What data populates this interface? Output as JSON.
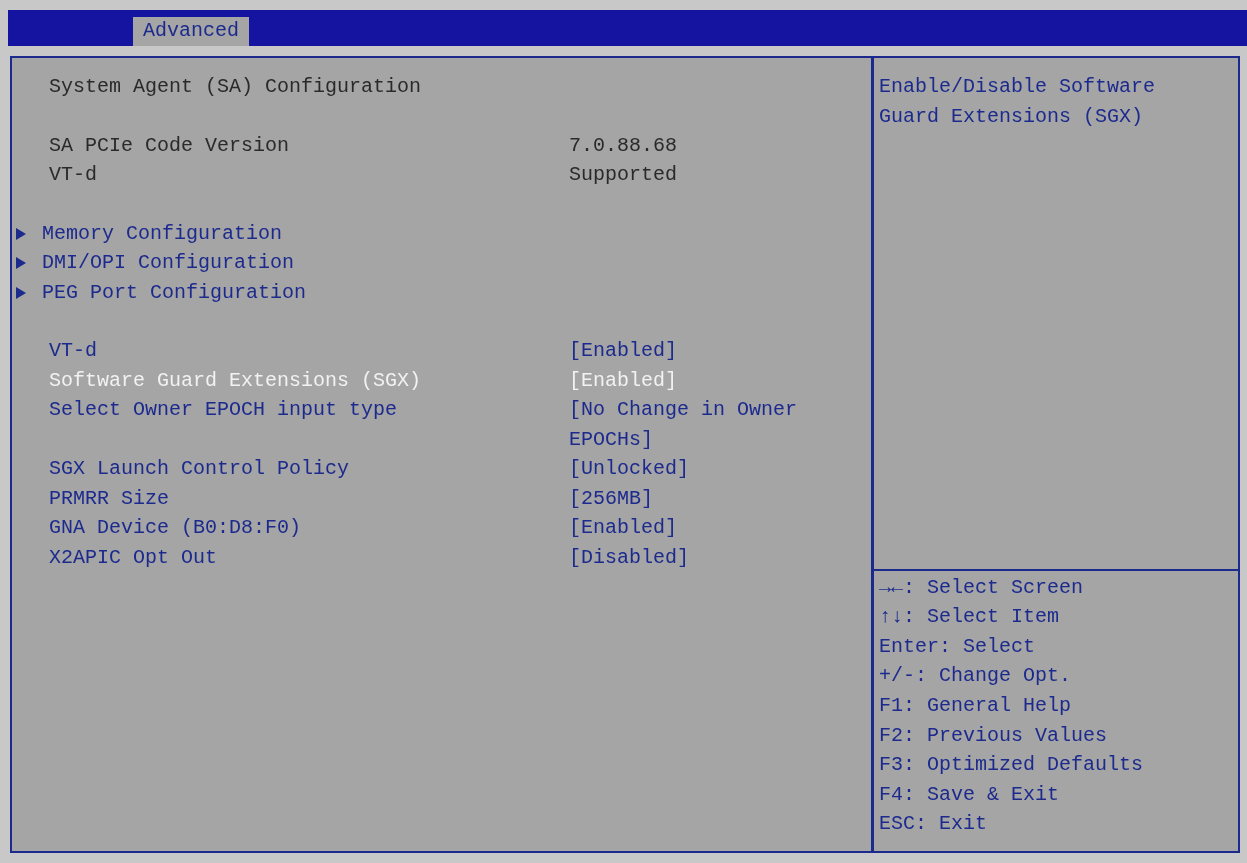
{
  "tabs": [
    {
      "label": "Advanced",
      "selected": true
    }
  ],
  "title": "System Agent (SA) Configuration",
  "groups": [
    {
      "items": [
        {
          "kind": "info",
          "label": "SA PCIe Code Version",
          "value": "7.0.88.68"
        },
        {
          "kind": "info",
          "label": "VT-d",
          "value": "Supported"
        }
      ]
    },
    {
      "items": [
        {
          "kind": "submenu",
          "label": "Memory Configuration",
          "selected": false
        },
        {
          "kind": "submenu",
          "label": "DMI/OPI Configuration",
          "selected": false
        },
        {
          "kind": "submenu",
          "label": "PEG Port Configuration",
          "selected": false
        }
      ]
    },
    {
      "items": [
        {
          "kind": "setting",
          "label": "VT-d",
          "value": "[Enabled]",
          "selected": false
        },
        {
          "kind": "setting",
          "label": "Software Guard Extensions (SGX)",
          "value": "[Enabled]",
          "selected": true
        },
        {
          "kind": "setting",
          "label": "Select Owner EPOCH input type",
          "value": "[No Change in Owner EPOCHs]",
          "selected": false
        },
        {
          "kind": "setting",
          "label": "SGX Launch Control Policy",
          "value": "[Unlocked]",
          "selected": false
        },
        {
          "kind": "setting",
          "label": "PRMRR Size",
          "value": "[256MB]",
          "selected": false
        },
        {
          "kind": "setting",
          "label": "GNA Device (B0:D8:F0)",
          "value": "[Enabled]",
          "selected": false
        },
        {
          "kind": "setting",
          "label": "X2APIC Opt Out",
          "value": "[Disabled]",
          "selected": false
        }
      ]
    }
  ],
  "help": "Enable/Disable Software Guard Extensions (SGX)",
  "keys": [
    "→←: Select Screen",
    "↑↓: Select Item",
    "Enter: Select",
    "+/-: Change Opt.",
    "F1: General Help",
    "F2: Previous Values",
    "F3: Optimized Defaults",
    "F4: Save & Exit",
    "ESC: Exit"
  ]
}
